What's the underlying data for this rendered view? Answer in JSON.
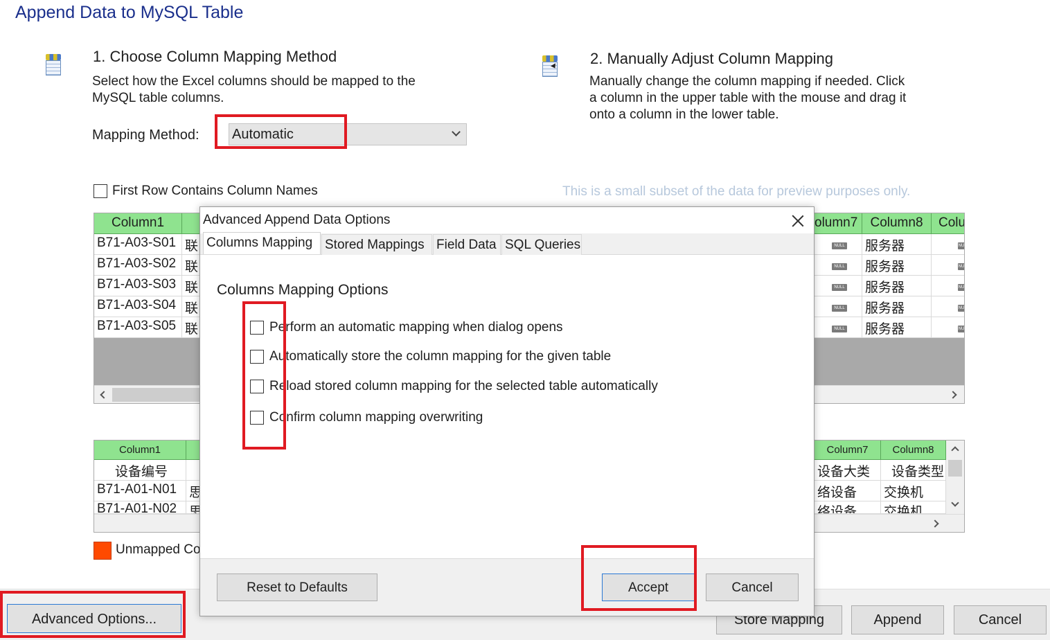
{
  "window": {
    "title": "Append Data to MySQL Table"
  },
  "step1": {
    "heading": "1. Choose Column Mapping Method",
    "desc_line1": "Select how the Excel columns should be mapped to the",
    "desc_line2": "MySQL table columns.",
    "method_label": "Mapping Method:",
    "method_value": "Automatic",
    "first_row_label": "First Row Contains Column Names"
  },
  "step2": {
    "heading": "2. Manually Adjust Column Mapping",
    "desc_line1": "Manually change the column mapping if needed. Click",
    "desc_line2": "a column in the upper table with the mouse and drag it",
    "desc_line3": "onto a column in the lower table."
  },
  "preview_hint": "This is a small subset of the data for preview purposes only.",
  "upper_grid": {
    "headers": {
      "col1": "Column1",
      "col7": "olumn7",
      "col8": "Column8",
      "col9": "Colu"
    },
    "rows": [
      {
        "c1": "B71-A03-S01",
        "c2": "联",
        "c7": "NULL",
        "c8": "服务器",
        "c9": "NU"
      },
      {
        "c1": "B71-A03-S02",
        "c2": "联",
        "c7": "NULL",
        "c8": "服务器",
        "c9": "NU"
      },
      {
        "c1": "B71-A03-S03",
        "c2": "联",
        "c7": "NULL",
        "c8": "服务器",
        "c9": "NU"
      },
      {
        "c1": "B71-A03-S04",
        "c2": "联",
        "c7": "NULL",
        "c8": "服务器",
        "c9": "NU"
      },
      {
        "c1": "B71-A03-S05",
        "c2": "联",
        "c7": "NULL",
        "c8": "服务器",
        "c9": "NU"
      }
    ]
  },
  "lower_grid": {
    "headers": {
      "col1": "Column1",
      "col7": "Column7",
      "col8": "Column8"
    },
    "names": {
      "col1": "设备编号",
      "col7": "设备大类",
      "col8": "设备类型"
    },
    "rows": [
      {
        "c1": "B71-A01-N01",
        "c2": "思",
        "c7": "络设备",
        "c8": "交换机"
      },
      {
        "c1": "B71-A01-N02",
        "c2": "思",
        "c7": "络设备",
        "c8": "交换机"
      }
    ]
  },
  "legend": {
    "unmapped_label": "Unmapped Co"
  },
  "buttons": {
    "advanced_options": "Advanced Options...",
    "store_mapping": "Store Mapping",
    "append": "Append",
    "cancel": "Cancel"
  },
  "dialog": {
    "title": "Advanced Append Data Options",
    "tabs": [
      "Columns Mapping",
      "Stored Mappings",
      "Field Data",
      "SQL Queries"
    ],
    "section_title": "Columns Mapping Options",
    "options": [
      {
        "label": "Perform an automatic mapping when dialog opens",
        "checked": false
      },
      {
        "label": "Automatically store the column mapping for the given table",
        "checked": false
      },
      {
        "label": "Reload stored column mapping for the selected table automatically",
        "checked": false
      },
      {
        "label": "Confirm column mapping overwriting",
        "checked": false
      }
    ],
    "reset_label": "Reset to Defaults",
    "accept_label": "Accept",
    "cancel_label": "Cancel"
  },
  "colors": {
    "accent_title": "#1a2f8c",
    "header_green": "#8fe38f",
    "unmapped": "#ff4a00",
    "highlight": "#e01a22"
  }
}
